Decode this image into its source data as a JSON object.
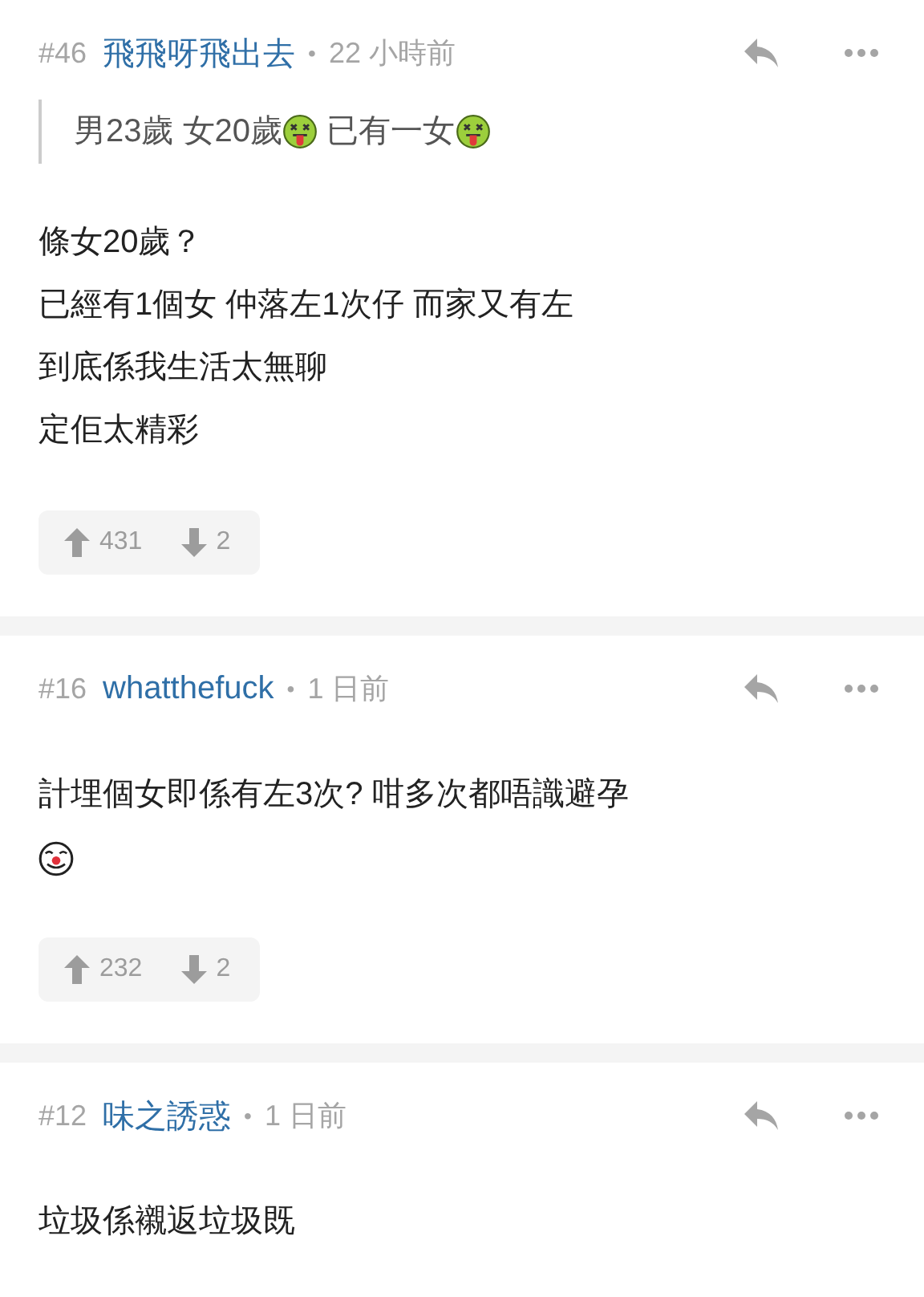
{
  "comments": [
    {
      "number": "#46",
      "author": "飛飛呀飛出去",
      "separator": "•",
      "time": "22 小時前",
      "quote": [
        [
          {
            "kind": "text",
            "text": "男23歲 女20歲"
          },
          {
            "kind": "sick-emoji"
          },
          {
            "kind": "text",
            "text": " 已有一女"
          },
          {
            "kind": "sick-emoji"
          }
        ]
      ],
      "body": [
        [
          {
            "kind": "text",
            "text": "條女20歲？"
          }
        ],
        [
          {
            "kind": "text",
            "text": "已經有1個女 仲落左1次仔 而家又有左"
          }
        ],
        [
          {
            "kind": "text",
            "text": "到底係我生活太無聊"
          }
        ],
        [
          {
            "kind": "text",
            "text": "定佢太精彩"
          }
        ]
      ],
      "upvotes": "431",
      "downvotes": "2"
    },
    {
      "number": "#16",
      "author": "whatthefuck",
      "separator": "•",
      "time": "1 日前",
      "body": [
        [
          {
            "kind": "text",
            "text": "計埋個女即係有左3次? 咁多次都唔識避孕"
          }
        ],
        [
          {
            "kind": "clown-emoji"
          }
        ]
      ],
      "upvotes": "232",
      "downvotes": "2"
    },
    {
      "number": "#12",
      "author": "味之誘惑",
      "separator": "•",
      "time": "1 日前",
      "body": [
        [
          {
            "kind": "text",
            "text": "垃圾係襯返垃圾既"
          }
        ]
      ]
    }
  ]
}
